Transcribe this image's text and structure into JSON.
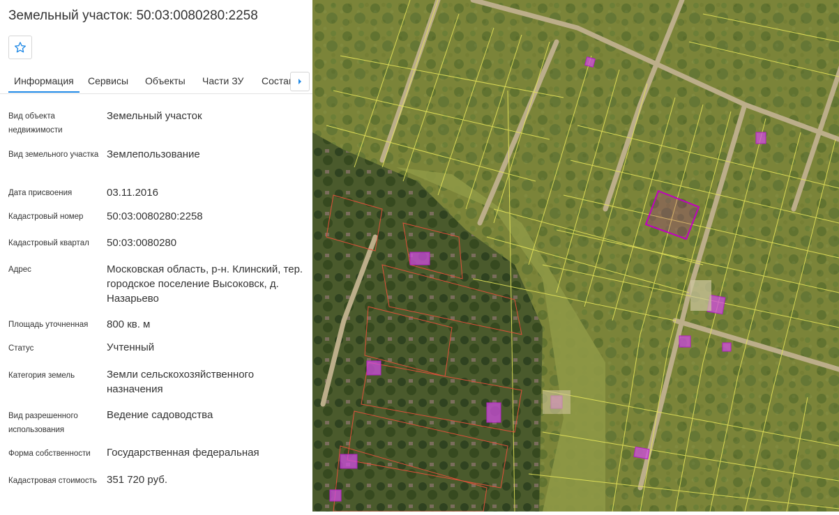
{
  "header": {
    "title": "Земельный участок: 50:03:0080280:2258",
    "favorite_icon": "star-outline-icon"
  },
  "tabs": [
    {
      "label": "Информация",
      "active": true
    },
    {
      "label": "Сервисы"
    },
    {
      "label": "Объекты"
    },
    {
      "label": "Части ЗУ"
    },
    {
      "label": "Состав"
    }
  ],
  "tab_scroll_icon": "chevron-right-icon",
  "details": [
    {
      "label": "Вид объекта недвижимости",
      "value": "Земельный участок"
    },
    {
      "label": "Вид земельного участка",
      "value": "Землепользование"
    },
    {
      "label": "Дата присвоения",
      "value": "03.11.2016"
    },
    {
      "label": "Кадастровый номер",
      "value": "50:03:0080280:2258"
    },
    {
      "label": "Кадастровый квартал",
      "value": "50:03:0080280"
    },
    {
      "label": "Адрес",
      "value": "Московская область, р-н. Клинский, тер. городское поселение Высоковск, д. Назарьево"
    },
    {
      "label": "Площадь уточненная",
      "value": "800 кв. м"
    },
    {
      "label": "Статус",
      "value": "Учтенный"
    },
    {
      "label": "Категория земель",
      "value": "Земли сельскохозяйственного назначения"
    },
    {
      "label": "Вид разрешенного использования",
      "value": "Ведение садоводства"
    },
    {
      "label": "Форма собственности",
      "value": "Государственная федеральная"
    },
    {
      "label": "Кадастровая стоимость",
      "value": "351 720 руб."
    }
  ],
  "map": {
    "type": "satellite-cadastral",
    "colors": {
      "parcel_border": "#e8e85a",
      "selected_parcel": "#c000c0",
      "building": "#d04ce0",
      "red_parcel": "#e0503a"
    }
  }
}
